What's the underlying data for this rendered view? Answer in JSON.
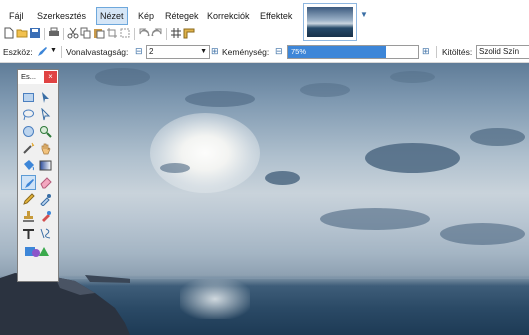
{
  "menubar": {
    "items": [
      "Fájl",
      "Szerkesztés",
      "Nézet",
      "Kép",
      "Rétegek",
      "Korrekciók",
      "Effektek"
    ],
    "active_index": 2
  },
  "toolbar2": {
    "tool_label": "Eszköz:",
    "brush_width_label": "Vonalvastagság:",
    "brush_width_value": "2",
    "hardness_label": "Keménység:",
    "hardness_value": "75%",
    "hardness_fraction": 0.75,
    "fill_label": "Kitöltés:",
    "fill_value": "Szolid Szín"
  },
  "tools_window": {
    "title": "Es...",
    "close_glyph": "×"
  },
  "colors": {
    "accent": "#3d86d8",
    "close_red": "#e04343",
    "menu_active_bg": "#d5e6f7"
  }
}
